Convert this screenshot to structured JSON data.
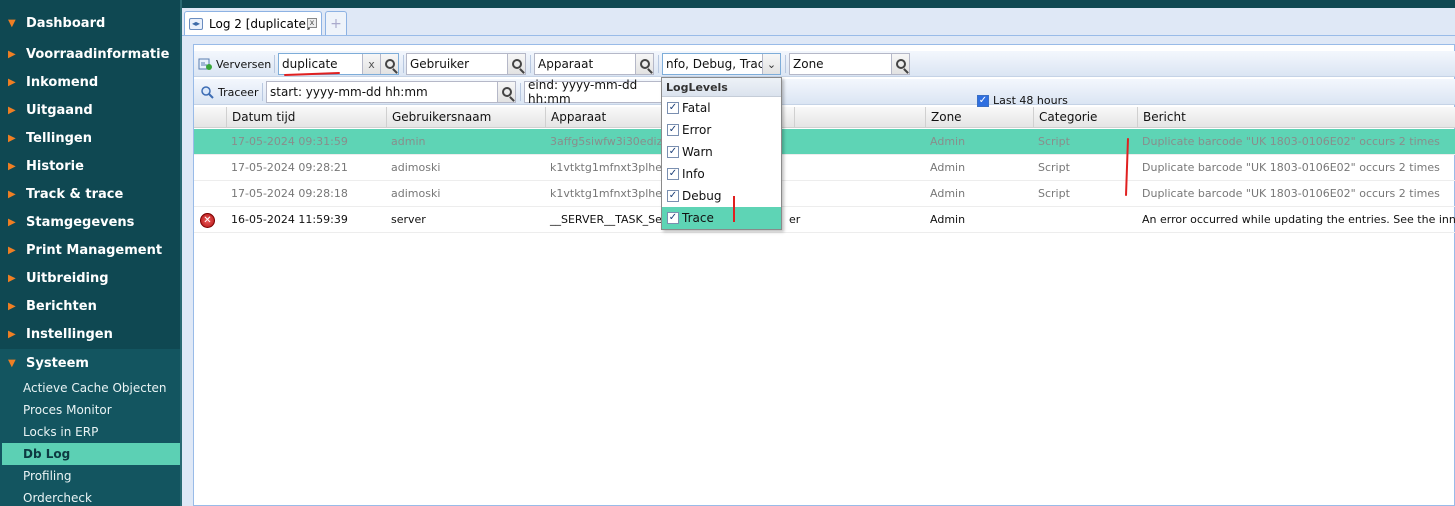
{
  "sidebar": {
    "items": [
      {
        "label": "Dashboard"
      },
      {
        "label": "Voorraadinformatie"
      },
      {
        "label": "Inkomend"
      },
      {
        "label": "Uitgaand"
      },
      {
        "label": "Tellingen"
      },
      {
        "label": "Historie"
      },
      {
        "label": "Track & trace"
      },
      {
        "label": "Stamgegevens"
      },
      {
        "label": "Print Management"
      },
      {
        "label": "Uitbreiding"
      },
      {
        "label": "Berichten"
      },
      {
        "label": "Instellingen"
      }
    ],
    "systeem": {
      "label": "Systeem",
      "subitems": [
        "Actieve Cache Objecten",
        "Proces Monitor",
        "Locks in ERP",
        "Db Log",
        "Profiling",
        "Ordercheck"
      ]
    }
  },
  "tabs": {
    "active_label": "Log 2 [duplicate]",
    "close_label": "x",
    "add_label": "+"
  },
  "toolbar": {
    "refresh_label": "Verversen",
    "search_value": "duplicate",
    "clear_label": "x",
    "user_placeholder": "Gebruiker",
    "device_placeholder": "Apparaat",
    "loglevels_value": "nfo, Debug, Trace",
    "zone_placeholder": "Zone",
    "trace_label": "Traceer",
    "start_value": "start: yyyy-mm-dd hh:mm",
    "end_value": "eind: yyyy-mm-dd hh:mm",
    "last48_label": "Last 48 hours"
  },
  "loglevels_menu": {
    "title": "LogLevels",
    "items": [
      "Fatal",
      "Error",
      "Warn",
      "Info",
      "Debug",
      "Trace"
    ],
    "checked": [
      true,
      true,
      true,
      true,
      true,
      true
    ],
    "highlighted": "Trace"
  },
  "grid": {
    "columns": [
      "Datum tijd",
      "Gebruikersnaam",
      "Apparaat",
      "",
      "Zone",
      "Categorie",
      "Bericht"
    ],
    "rows": [
      {
        "datetime": "17-05-2024 09:31:59",
        "user": "admin",
        "device": "3affg5siwfw3i30ediz0",
        "device_tail": "",
        "zone": "Admin",
        "category": "Script",
        "message": "Duplicate barcode \"UK 1803-0106E02\" occurs 2 times",
        "state": "selected"
      },
      {
        "datetime": "17-05-2024 09:28:21",
        "user": "adimoski",
        "device": "k1vtktg1mfnxt3plhe4su",
        "device_tail": "",
        "zone": "Admin",
        "category": "Script",
        "message": "Duplicate barcode \"UK 1803-0106E02\" occurs 2 times",
        "state": "muted"
      },
      {
        "datetime": "17-05-2024 09:28:18",
        "user": "adimoski",
        "device": "k1vtktg1mfnxt3plhe4su",
        "device_tail": "",
        "zone": "Admin",
        "category": "Script",
        "message": "Duplicate barcode \"UK 1803-0106E02\" occurs 2 times",
        "state": "muted"
      },
      {
        "datetime": "16-05-2024 11:59:39",
        "user": "server",
        "device": "__SERVER__TASK_Se",
        "device_tail": "er",
        "zone": "Admin",
        "category": "",
        "message": "An error occurred while updating the entries. See the inner excep",
        "state": "error"
      }
    ]
  }
}
